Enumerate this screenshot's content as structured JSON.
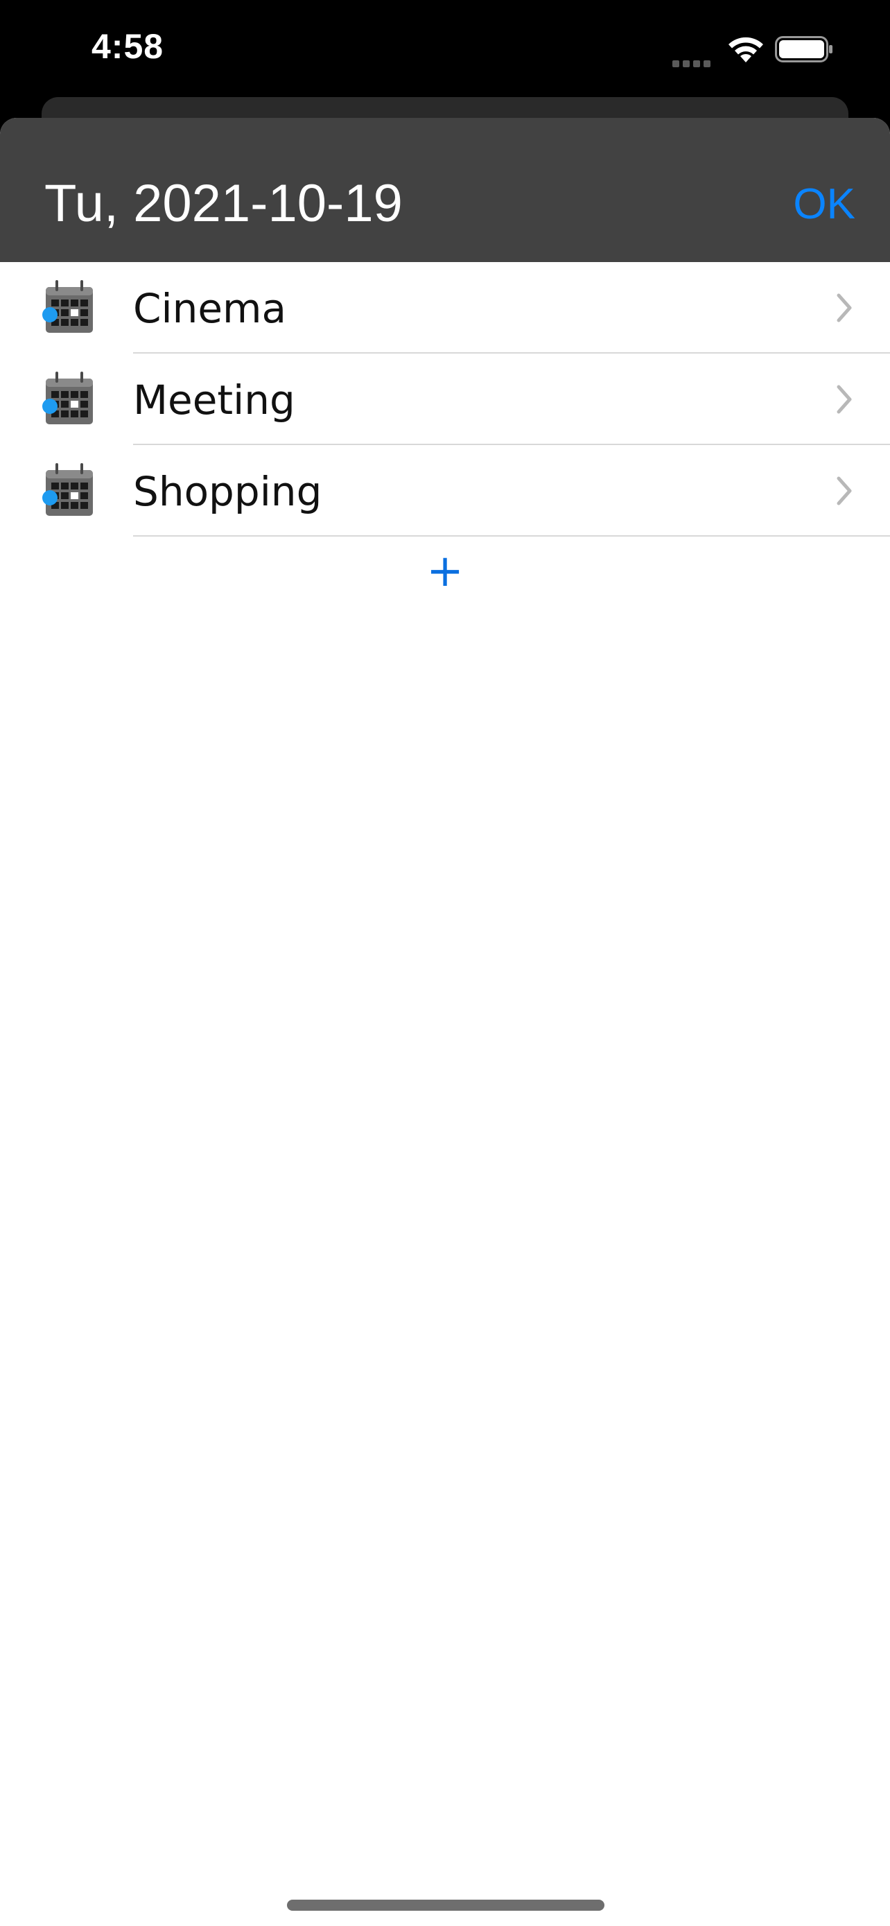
{
  "status_bar": {
    "time": "4:58",
    "icons": [
      "cellular-signal-icon",
      "wifi-icon",
      "battery-icon"
    ]
  },
  "header": {
    "title": "Tu, 2021-10-19",
    "ok_label": "OK"
  },
  "events": [
    {
      "label": "Cinema",
      "icon": "calendar-icon"
    },
    {
      "label": "Meeting",
      "icon": "calendar-icon"
    },
    {
      "label": "Shopping",
      "icon": "calendar-icon"
    }
  ],
  "add_button": {
    "label": "+"
  },
  "colors": {
    "accent": "#0a84ff",
    "header_bg": "#424242",
    "status_dot": "#1e9bf0"
  }
}
